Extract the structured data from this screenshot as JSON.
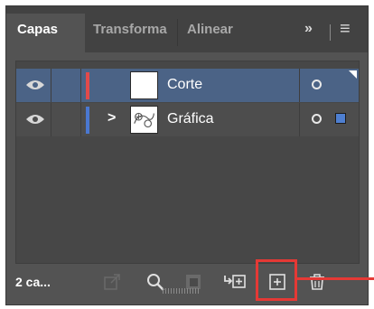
{
  "tabs": [
    {
      "label": "Capas",
      "active": true
    },
    {
      "label": "Transforma",
      "active": false
    },
    {
      "label": "Alinear",
      "active": false
    }
  ],
  "tab_controls": {
    "expand": "»",
    "menu": "≡"
  },
  "layers": [
    {
      "name": "Corte",
      "color": "#e24a4a",
      "selected": true,
      "expandable": false,
      "thumbnail": "blank"
    },
    {
      "name": "Gráfica",
      "color": "#4a78d1",
      "selected": false,
      "expandable": true,
      "thumbnail": "drawing",
      "has_selection": true
    }
  ],
  "footer": {
    "count_label": "2 ca...",
    "icons": [
      "collect-for-export-icon",
      "locate-object-icon",
      "make-clipping-mask-icon",
      "create-sublayer-icon",
      "create-new-layer-icon",
      "delete-layer-icon"
    ]
  },
  "annotation": {
    "color": "#e53935",
    "target": "create-new-layer-icon"
  }
}
